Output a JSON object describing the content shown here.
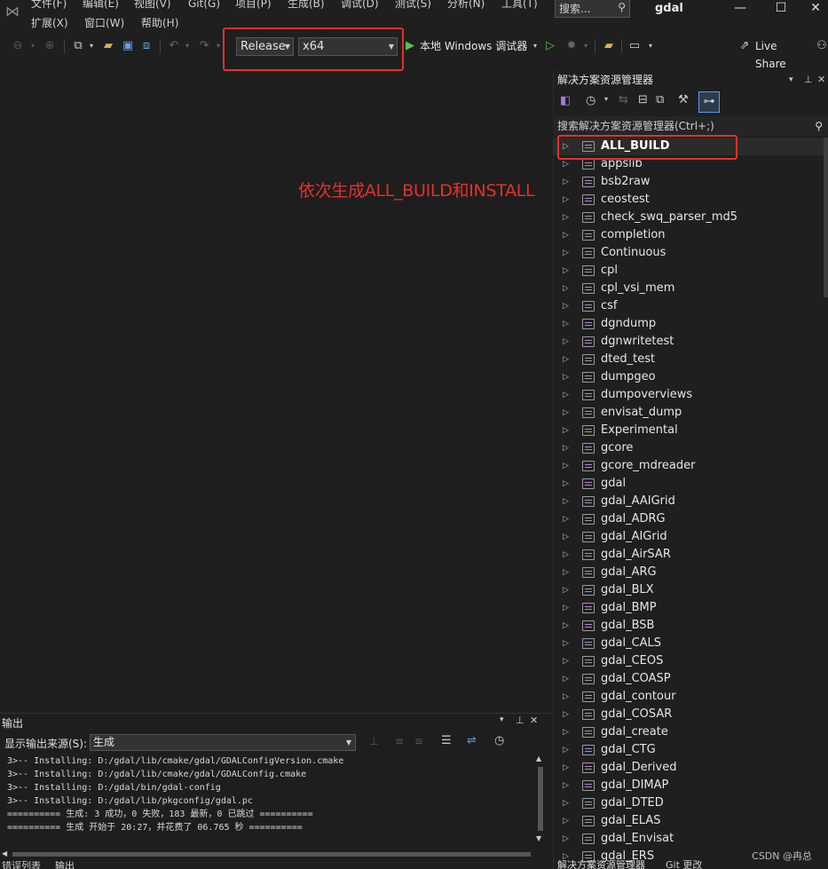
{
  "menu": {
    "row1": [
      "文件(F)",
      "编辑(E)",
      "视图(V)",
      "Git(G)",
      "项目(P)",
      "生成(B)",
      "调试(D)",
      "测试(S)",
      "分析(N)",
      "工具(T)"
    ],
    "row2": [
      "扩展(X)",
      "窗口(W)",
      "帮助(H)"
    ]
  },
  "search": {
    "placeholder": "搜索..."
  },
  "window": {
    "title": "gdal",
    "minimize": "—",
    "maximize": "☐",
    "close": "✕"
  },
  "toolbar": {
    "config": "Release",
    "platform": "x64",
    "run_label": "本地 Windows 调试器",
    "live_share": "Live Share"
  },
  "annotation": "依次生成ALL_BUILD和INSTALL",
  "solution_explorer": {
    "title": "解决方案资源管理器",
    "search_placeholder": "搜索解决方案资源管理器(Ctrl+;)",
    "items": [
      "ALL_BUILD",
      "appslib",
      "bsb2raw",
      "ceostest",
      "check_swq_parser_md5",
      "completion",
      "Continuous",
      "cpl",
      "cpl_vsi_mem",
      "csf",
      "dgndump",
      "dgnwritetest",
      "dted_test",
      "dumpgeo",
      "dumpoverviews",
      "envisat_dump",
      "Experimental",
      "gcore",
      "gcore_mdreader",
      "gdal",
      "gdal_AAIGrid",
      "gdal_ADRG",
      "gdal_AIGrid",
      "gdal_AirSAR",
      "gdal_ARG",
      "gdal_BLX",
      "gdal_BMP",
      "gdal_BSB",
      "gdal_CALS",
      "gdal_CEOS",
      "gdal_COASP",
      "gdal_contour",
      "gdal_COSAR",
      "gdal_create",
      "gdal_CTG",
      "gdal_Derived",
      "gdal_DIMAP",
      "gdal_DTED",
      "gdal_ELAS",
      "gdal_Envisat",
      "gdal_ERS"
    ],
    "bottom_tabs": [
      "解决方案资源管理器",
      "Git 更改"
    ]
  },
  "output": {
    "title": "输出",
    "source_label": "显示输出来源(S):",
    "source_value": "生成",
    "lines": [
      "3>-- Installing: D:/gdal/lib/cmake/gdal/GDALConfigVersion.cmake",
      "3>-- Installing: D:/gdal/lib/cmake/gdal/GDALConfig.cmake",
      "3>-- Installing: D:/gdal/bin/gdal-config",
      "3>-- Installing: D:/gdal/lib/pkgconfig/gdal.pc",
      "========== 生成: 3 成功，0 失败，183 最新，0 已跳过 ==========",
      "========== 生成 开始于 20:27，并花费了 06.765 秒 =========="
    ],
    "bottom_tabs": [
      "错误列表",
      "输出"
    ]
  },
  "watermark": "CSDN @冉总",
  "colors": {
    "accent_red": "#e4312b",
    "run_green": "#4ec94e",
    "bg": "#1e1e1e"
  }
}
